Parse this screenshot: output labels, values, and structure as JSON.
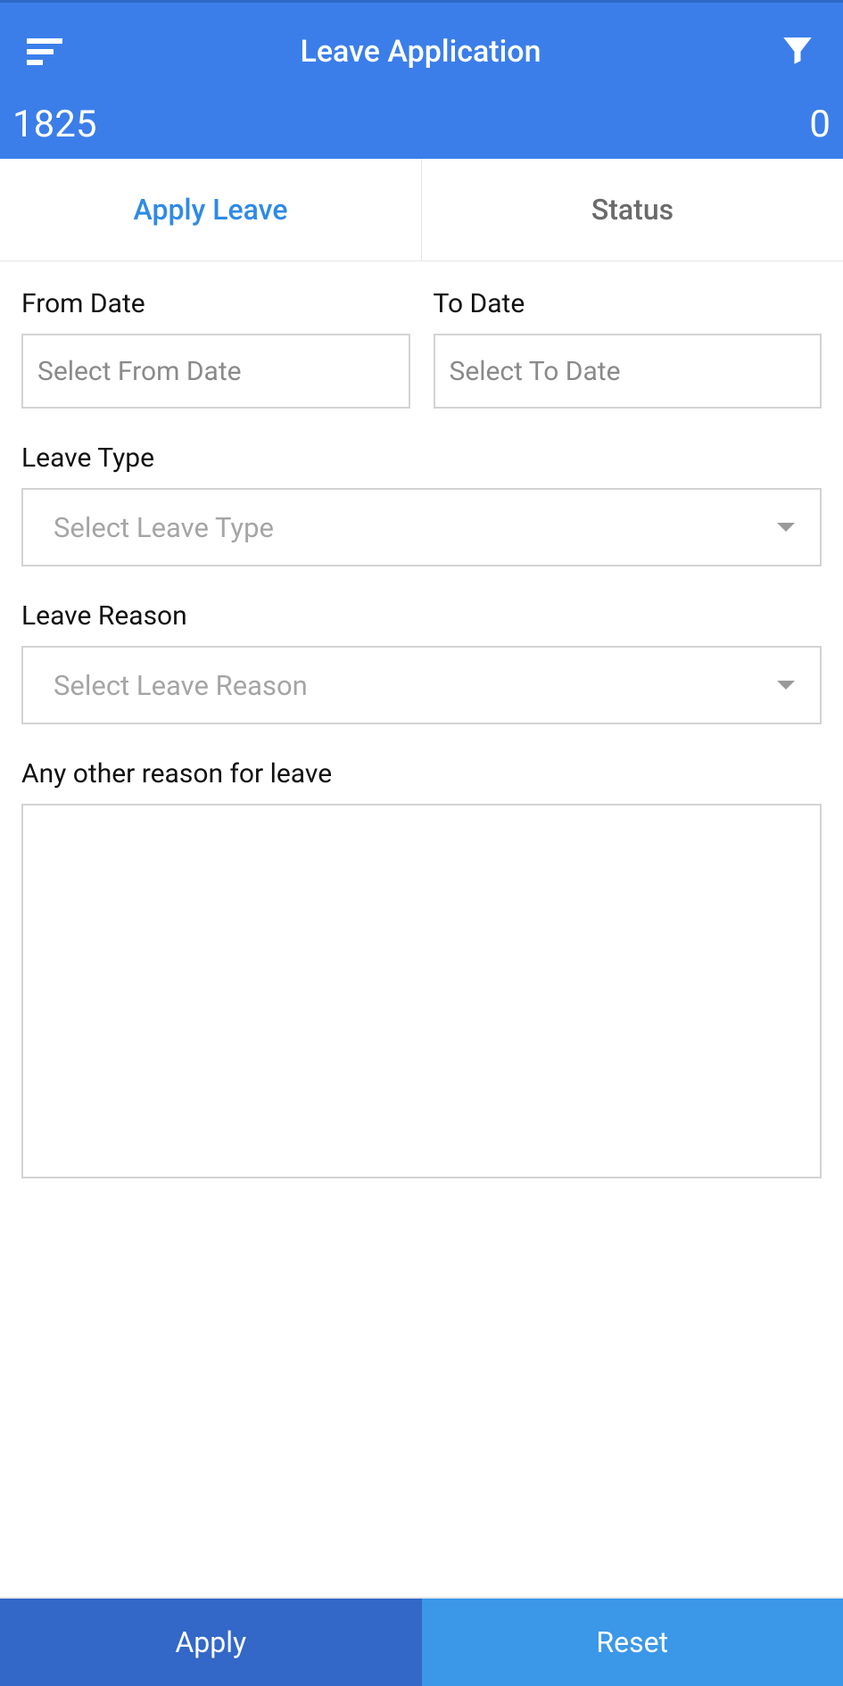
{
  "header": {
    "title": "Leave Application",
    "stat_left": "1825",
    "stat_right": "0"
  },
  "tabs": {
    "apply": "Apply Leave",
    "status": "Status"
  },
  "form": {
    "from_date_label": "From Date",
    "from_date_placeholder": "Select From Date",
    "to_date_label": "To Date",
    "to_date_placeholder": "Select To Date",
    "leave_type_label": "Leave Type",
    "leave_type_placeholder": "Select Leave Type",
    "leave_reason_label": "Leave Reason",
    "leave_reason_placeholder": "Select Leave Reason",
    "other_reason_label": "Any other reason for leave"
  },
  "buttons": {
    "apply": "Apply",
    "reset": "Reset"
  }
}
